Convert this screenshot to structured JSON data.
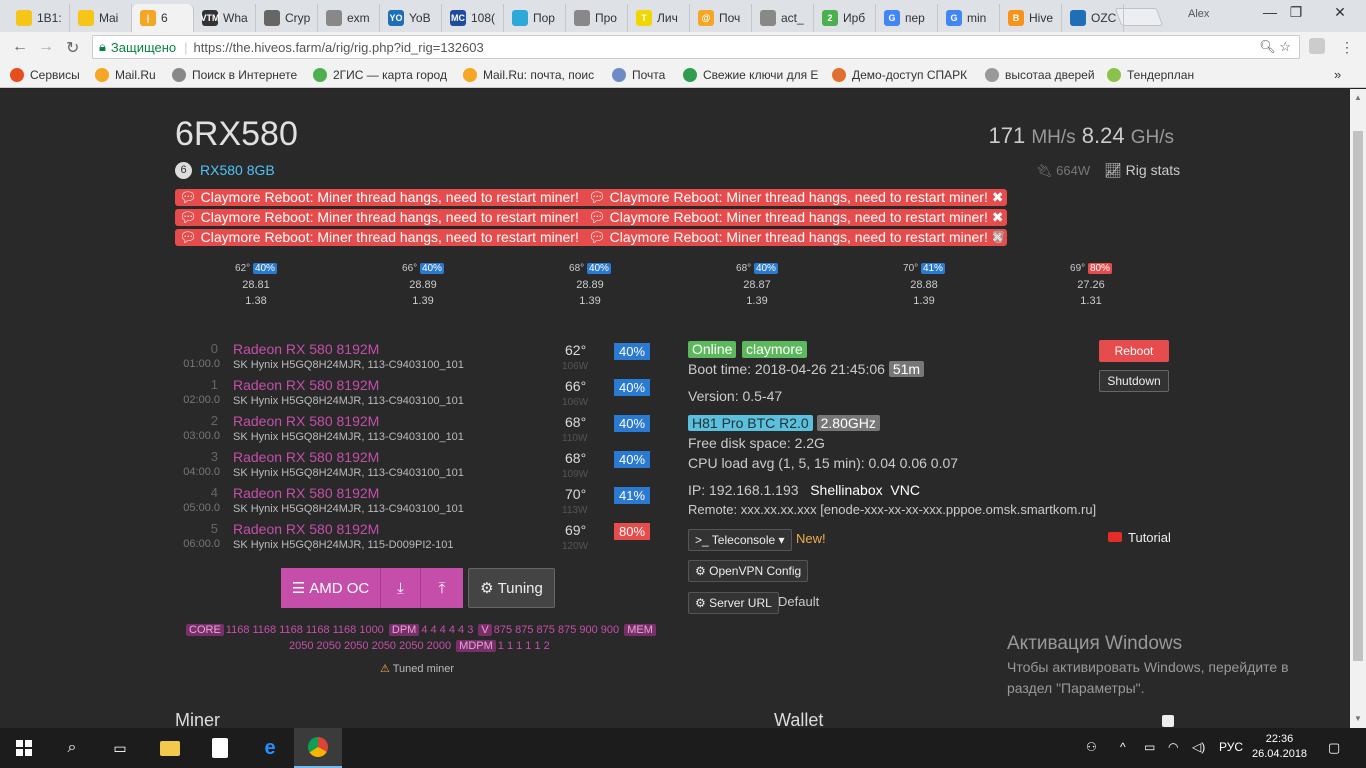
{
  "browser": {
    "tabs": [
      {
        "label": "1B1:",
        "color": "#f5c518",
        "icon_text": ""
      },
      {
        "label": "Mai",
        "color": "#f5c518",
        "icon_text": ""
      },
      {
        "label": "6",
        "color": "#f5a623",
        "icon_text": "|"
      },
      {
        "label": "Wha",
        "color": "#333333",
        "icon_text": "VTM"
      },
      {
        "label": "Cryp",
        "color": "#666666",
        "icon_text": ""
      },
      {
        "label": "exm",
        "color": "#888888",
        "icon_text": ""
      },
      {
        "label": "YoB",
        "color": "#1e6fb8",
        "icon_text": "YO"
      },
      {
        "label": "108(",
        "color": "#1e4aa0",
        "icon_text": "MC"
      },
      {
        "label": "Пор",
        "color": "#2ea8d6",
        "icon_text": ""
      },
      {
        "label": "Про",
        "color": "#888888",
        "icon_text": ""
      },
      {
        "label": "Лич",
        "color": "#f2d600",
        "icon_text": "T"
      },
      {
        "label": "Поч",
        "color": "#f5a623",
        "icon_text": "@"
      },
      {
        "label": "act_",
        "color": "#888888",
        "icon_text": ""
      },
      {
        "label": "Ирб",
        "color": "#4caf50",
        "icon_text": "2"
      },
      {
        "label": "пер",
        "color": "#4285f4",
        "icon_text": "G"
      },
      {
        "label": "min",
        "color": "#4285f4",
        "icon_text": "G"
      },
      {
        "label": "Hive",
        "color": "#f7931a",
        "icon_text": "B"
      },
      {
        "label": "OZC",
        "color": "#1e6fb8",
        "icon_text": ""
      }
    ],
    "user": "Alex",
    "secure_label": "Защищено",
    "url": "https://the.hiveos.farm/a/rig/rig.php?id_rig=132603",
    "bookmarks": [
      {
        "label": "Сервисы",
        "color": "#e84e1b"
      },
      {
        "label": "Mail.Ru",
        "color": "#f5a623"
      },
      {
        "label": "Поиск в Интернете",
        "color": "#888888"
      },
      {
        "label": "2ГИС — карта город",
        "color": "#4caf50"
      },
      {
        "label": "Mail.Ru: почта, поис",
        "color": "#f5a623"
      },
      {
        "label": "Почта",
        "color": "#6b8cc7"
      },
      {
        "label": "Свежие ключи для E",
        "color": "#2e9e4e"
      },
      {
        "label": "Демо-доступ СПАРК",
        "color": "#e07030"
      },
      {
        "label": "высотаа дверей",
        "color": "#999999"
      },
      {
        "label": "Тендерплан",
        "color": "#8bc34a"
      }
    ]
  },
  "rig": {
    "name": "6RX580",
    "hashrate_main": "171",
    "hashrate_main_unit": "MH/s",
    "hashrate_second": "8.24",
    "hashrate_second_unit": "GH/s",
    "gpu_count": "6",
    "gpu_model": "RX580 8GB",
    "power": "664W",
    "rig_stats_label": "Rig stats"
  },
  "alerts": [
    "Claymore Reboot: Miner thread hangs, need to restart miner!",
    "Claymore Reboot: Miner thread hangs, need to restart miner!",
    "Claymore Reboot: Miner thread hangs, need to restart miner!",
    "Claymore Reboot: Miner thread hangs, need to restart miner!",
    "Claymore Reboot: Miner thread hangs, need to restart miner!",
    "Claymore Reboot: Miner thread hangs, need to restart miner!"
  ],
  "summary": [
    {
      "temp": "62°",
      "fan": "40%",
      "fan_alert": false,
      "h1": "28.81",
      "h2": "1.38"
    },
    {
      "temp": "66°",
      "fan": "40%",
      "fan_alert": false,
      "h1": "28.89",
      "h2": "1.39"
    },
    {
      "temp": "68°",
      "fan": "40%",
      "fan_alert": false,
      "h1": "28.89",
      "h2": "1.39"
    },
    {
      "temp": "68°",
      "fan": "40%",
      "fan_alert": false,
      "h1": "28.87",
      "h2": "1.39"
    },
    {
      "temp": "70°",
      "fan": "41%",
      "fan_alert": false,
      "h1": "28.88",
      "h2": "1.39"
    },
    {
      "temp": "69°",
      "fan": "80%",
      "fan_alert": true,
      "h1": "27.26",
      "h2": "1.31"
    }
  ],
  "gpus": [
    {
      "index": "0",
      "bus": "01:00.0",
      "name": "Radeon RX 580 8192M",
      "mem": "SK Hynix H5GQ8H24MJR, 113-C9403100_101",
      "temp": "62°",
      "power": "106W",
      "fan": "40%",
      "fan_alert": false
    },
    {
      "index": "1",
      "bus": "02:00.0",
      "name": "Radeon RX 580 8192M",
      "mem": "SK Hynix H5GQ8H24MJR, 113-C9403100_101",
      "temp": "66°",
      "power": "106W",
      "fan": "40%",
      "fan_alert": false
    },
    {
      "index": "2",
      "bus": "03:00.0",
      "name": "Radeon RX 580 8192M",
      "mem": "SK Hynix H5GQ8H24MJR, 113-C9403100_101",
      "temp": "68°",
      "power": "110W",
      "fan": "40%",
      "fan_alert": false
    },
    {
      "index": "3",
      "bus": "04:00.0",
      "name": "Radeon RX 580 8192M",
      "mem": "SK Hynix H5GQ8H24MJR, 113-C9403100_101",
      "temp": "68°",
      "power": "109W",
      "fan": "40%",
      "fan_alert": false
    },
    {
      "index": "4",
      "bus": "05:00.0",
      "name": "Radeon RX 580 8192M",
      "mem": "SK Hynix H5GQ8H24MJR, 113-C9403100_101",
      "temp": "70°",
      "power": "113W",
      "fan": "41%",
      "fan_alert": false
    },
    {
      "index": "5",
      "bus": "06:00.0",
      "name": "Radeon RX 580 8192M",
      "mem": "SK Hynix H5GQ8H24MJR, 115-D009PI2-101",
      "temp": "69°",
      "power": "120W",
      "fan": "80%",
      "fan_alert": true
    }
  ],
  "oc": {
    "amd_oc_label": "AMD OC",
    "tuning_label": "Tuning",
    "core_tag": "CORE",
    "core_values": "1168 1168 1168 1168 1168 1000",
    "dpm_tag": "DPM",
    "dpm_values": "4 4 4 4 4 3",
    "v_tag": "V",
    "v_values": "875 875 875 875 900 900",
    "mem_tag": "MEM",
    "mem_values": "2050 2050 2050 2050 2050 2000",
    "mdpm_tag": "MDPM",
    "mdpm_values": "1 1 1 1 1 2",
    "tuned_label": "Tuned miner"
  },
  "status": {
    "online": "Online",
    "miner": "claymore",
    "boot_time_label": "Boot time: 2018-04-26 21:45:06",
    "uptime": "51m",
    "version": "Version: 0.5-47",
    "motherboard": "H81 Pro BTC R2.0",
    "cpu_freq": "2.80GHz",
    "disk": "Free disk space: 2.2G",
    "cpu_load": "CPU load avg (1, 5, 15 min): 0.04 0.06 0.07",
    "ip": "IP: 192.168.1.193",
    "shellinabox": "Shellinabox",
    "vnc": "VNC",
    "remote": "Remote: xxx.xx.xx.xxx [enode-xxx-xx-xx-xxx.pppoe.omsk.smartkom.ru]",
    "teleconsole": ">_ Teleconsole",
    "new_label": "New!",
    "tutorial": "Tutorial",
    "openvpn": "OpenVPN Config",
    "server_url": "Server URL",
    "default_label": "Default",
    "reboot": "Reboot",
    "shutdown": "Shutdown"
  },
  "windows_activation": {
    "title": "Активация Windows",
    "line1": "Чтобы активировать Windows, перейдите в",
    "line2": "раздел \"Параметры\"."
  },
  "sections": {
    "miner": "Miner",
    "wallet": "Wallet"
  },
  "taskbar": {
    "lang": "РУС",
    "time": "22:36",
    "date": "26.04.2018"
  },
  "colors": {
    "page_bg": "#292929",
    "accent_magenta": "#c64eab",
    "alert_red": "#e74c4c",
    "fan_blue": "#2b7ad1",
    "online_green": "#5cb85c"
  }
}
